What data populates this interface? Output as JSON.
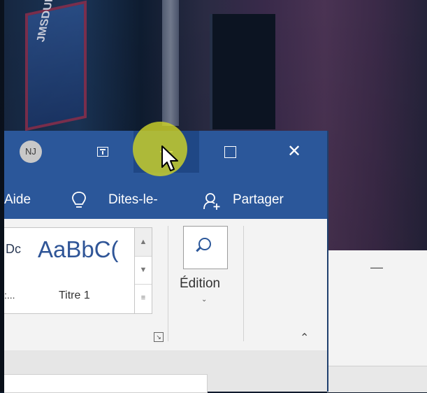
{
  "colors": {
    "word_blue": "#2b579a",
    "minimize_hover": "#1f4785",
    "cursor_halo": "#cdd228"
  },
  "background": {
    "sign_text": "JMSDUDO"
  },
  "titlebar": {
    "avatar_initials": "NJ",
    "icons": [
      "ribbon-display-options-icon",
      "minimize-icon",
      "maximize-icon",
      "close-icon"
    ],
    "close_glyph": "✕"
  },
  "tabs": {
    "aide": "Aide",
    "tell_me": "Dites-le-",
    "share": "Partager"
  },
  "ribbon": {
    "styles": {
      "prev_sample": "Dc",
      "titre1_sample": "AaBbC(",
      "prev_label": ":...",
      "titre1_label": "Titre 1"
    },
    "scroll": {
      "up": "▲",
      "down": "▼",
      "more": "≡"
    },
    "edit_label": "Édition",
    "edit_chevron": "⌄",
    "launcher": "↘",
    "collapse": "⌃"
  },
  "behind_window": {
    "minimize_glyph": "—"
  }
}
